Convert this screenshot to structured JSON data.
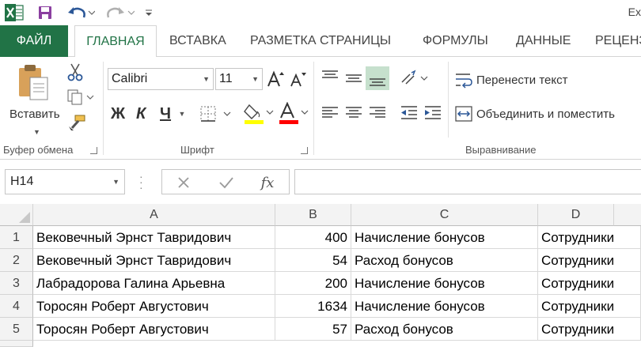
{
  "window": {
    "title": "Ex"
  },
  "tabs": {
    "file": "ФАЙЛ",
    "home": "ГЛАВНАЯ",
    "insert": "ВСТАВКА",
    "layout": "РАЗМЕТКА СТРАНИЦЫ",
    "formulas": "ФОРМУЛЫ",
    "data": "ДАННЫЕ",
    "review": "РЕЦЕНЗ"
  },
  "ribbon": {
    "clipboard": {
      "paste_label": "Вставить",
      "group_label": "Буфер обмена"
    },
    "font": {
      "font_name": "Calibri",
      "font_size": "11",
      "bold": "Ж",
      "italic": "К",
      "underline": "Ч",
      "group_label": "Шрифт"
    },
    "alignment": {
      "wrap_text": "Перенести текст",
      "merge_center": "Объединить и поместить",
      "group_label": "Выравнивание"
    }
  },
  "formula_bar": {
    "name_box": "H14",
    "formula": "",
    "fx_label": "fx"
  },
  "grid": {
    "columns": [
      "A",
      "B",
      "C",
      "D"
    ],
    "rows": [
      {
        "num": "1",
        "a": "Вековечный Эрнст Тавридович",
        "b": "400",
        "c": "Начисление бонусов",
        "d": "Сотрудники"
      },
      {
        "num": "2",
        "a": "Вековечный Эрнст Тавридович",
        "b": "54",
        "c": "Расход бонусов",
        "d": "Сотрудники"
      },
      {
        "num": "3",
        "a": "Лабрадорова Галина Арьевна",
        "b": "200",
        "c": "Начисление бонусов",
        "d": "Сотрудники"
      },
      {
        "num": "4",
        "a": "Торосян Роберт Августович",
        "b": "1634",
        "c": "Начисление бонусов",
        "d": "Сотрудники"
      },
      {
        "num": "5",
        "a": "Торосян Роберт Августович",
        "b": "57",
        "c": "Расход бонусов",
        "d": "Сотрудники"
      }
    ]
  },
  "colors": {
    "accent": "#217346",
    "fill_color": "#ffff00",
    "font_color": "#ff0000"
  }
}
